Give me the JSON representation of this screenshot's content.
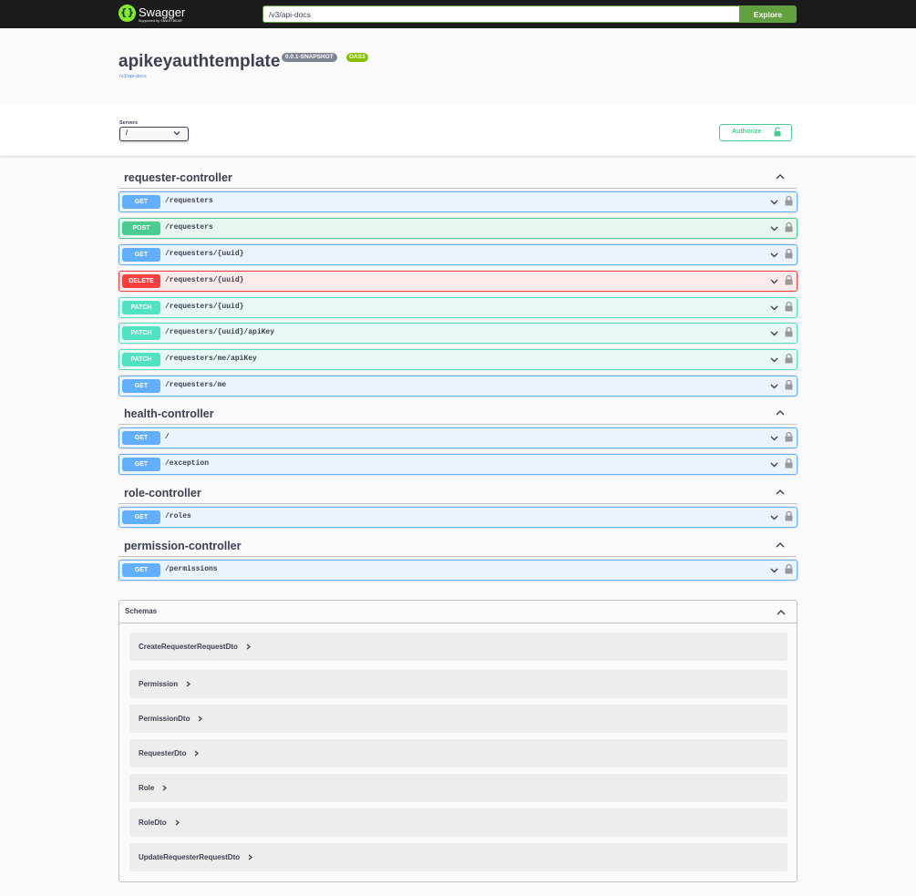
{
  "topbar": {
    "logo_text": "Swagger",
    "logo_sub": "Supported by SMARTBEAR",
    "url_value": "/v3/api-docs",
    "explore_label": "Explore"
  },
  "info": {
    "title": "apikeyauthtemplate",
    "version": "0.0.1-SNAPSHOT",
    "oas": "OAS3",
    "docs_link": "/v3/api-docs"
  },
  "servers": {
    "label": "Servers",
    "selected": "/"
  },
  "authorize_label": "Authorize",
  "colors": {
    "get": "#61affe",
    "post": "#49cc90",
    "delete": "#f93e3e",
    "patch": "#50e3c2",
    "explore": "#62a03f",
    "oas_badge": "#89bf04"
  },
  "tags": [
    {
      "name": "requester-controller",
      "operations": [
        {
          "method": "GET",
          "path": "/requesters"
        },
        {
          "method": "POST",
          "path": "/requesters"
        },
        {
          "method": "GET",
          "path": "/requesters/{uuid}"
        },
        {
          "method": "DELETE",
          "path": "/requesters/{uuid}"
        },
        {
          "method": "PATCH",
          "path": "/requesters/{uuid}"
        },
        {
          "method": "PATCH",
          "path": "/requesters/{uuid}/apiKey"
        },
        {
          "method": "PATCH",
          "path": "/requesters/me/apiKey"
        },
        {
          "method": "GET",
          "path": "/requesters/me"
        }
      ]
    },
    {
      "name": "health-controller",
      "operations": [
        {
          "method": "GET",
          "path": "/"
        },
        {
          "method": "GET",
          "path": "/exception"
        }
      ]
    },
    {
      "name": "role-controller",
      "operations": [
        {
          "method": "GET",
          "path": "/roles"
        }
      ]
    },
    {
      "name": "permission-controller",
      "operations": [
        {
          "method": "GET",
          "path": "/permissions"
        }
      ]
    }
  ],
  "schemas": {
    "title": "Schemas",
    "models": [
      "CreateRequesterRequestDto",
      "Permission",
      "PermissionDto",
      "RequesterDto",
      "Role",
      "RoleDto",
      "UpdateRequesterRequestDto"
    ]
  }
}
